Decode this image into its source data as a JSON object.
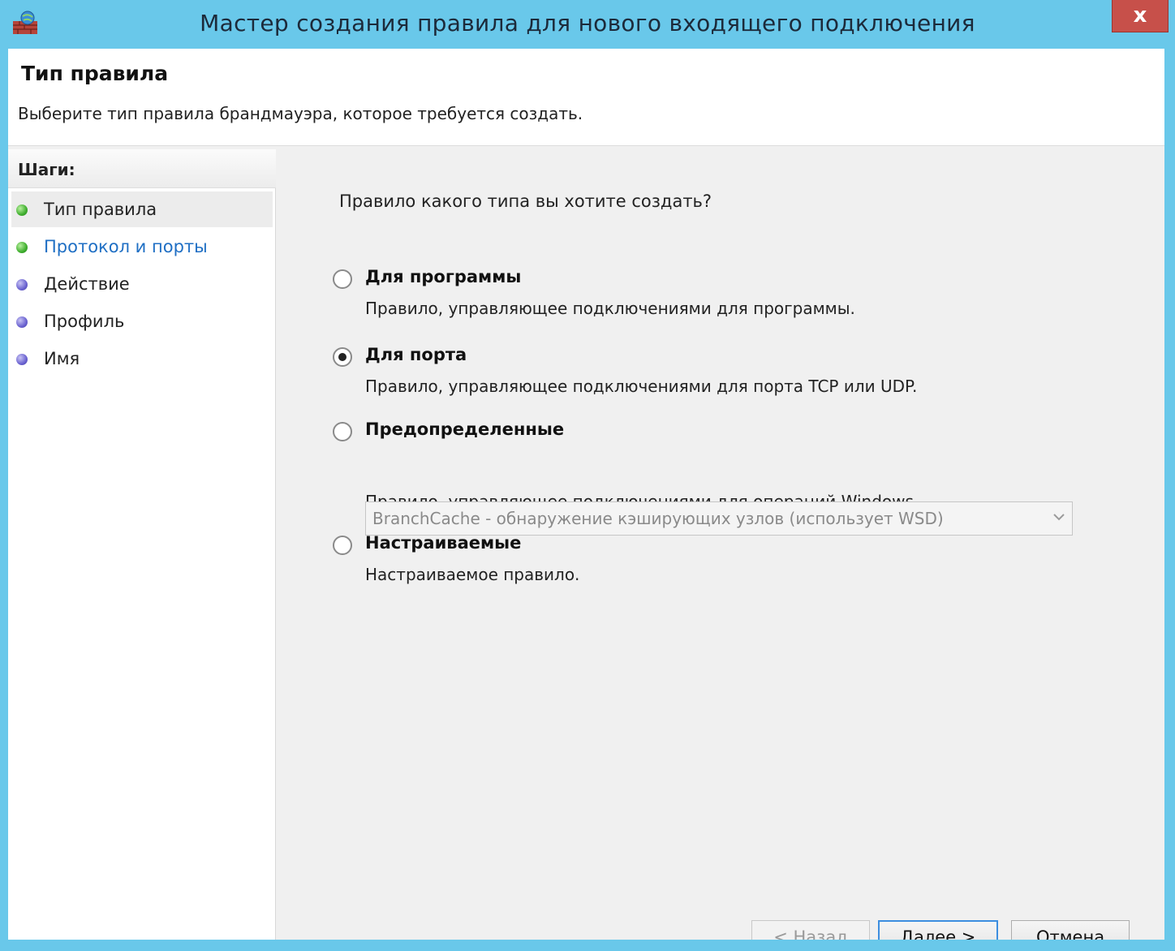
{
  "window": {
    "title": "Мастер создания правила для нового входящего подключения",
    "close_label": "x",
    "icon": "firewall-icon",
    "accent_color": "#69c8ea"
  },
  "header": {
    "title": "Тип правила",
    "subtitle": "Выберите тип правила брандмауэра, которое требуется создать."
  },
  "sidebar": {
    "heading": "Шаги:",
    "steps": [
      {
        "label": "Тип правила",
        "status": "green",
        "active": true
      },
      {
        "label": "Протокол и порты",
        "status": "green",
        "link": true
      },
      {
        "label": "Действие",
        "status": "blue"
      },
      {
        "label": "Профиль",
        "status": "blue"
      },
      {
        "label": "Имя",
        "status": "blue"
      }
    ]
  },
  "main": {
    "question": "Правило какого типа вы хотите создать?",
    "options": [
      {
        "label": "Для программы",
        "description": "Правило, управляющее подключениями для программы.",
        "checked": false
      },
      {
        "label": "Для порта",
        "description": "Правило, управляющее подключениями для порта TCP или UDP.",
        "checked": true
      },
      {
        "label": "Предопределенные",
        "description": "Правило, управляющее подключениями для операций Windows.",
        "checked": false
      },
      {
        "label": "Настраиваемые",
        "description": "Настраиваемое правило.",
        "checked": false
      }
    ],
    "predefined_select": {
      "value": "BranchCache - обнаружение кэширующих узлов (использует WSD)"
    }
  },
  "footer": {
    "back_label": "< Назад",
    "next_label": "Далее >",
    "cancel_label": "Отмена"
  }
}
